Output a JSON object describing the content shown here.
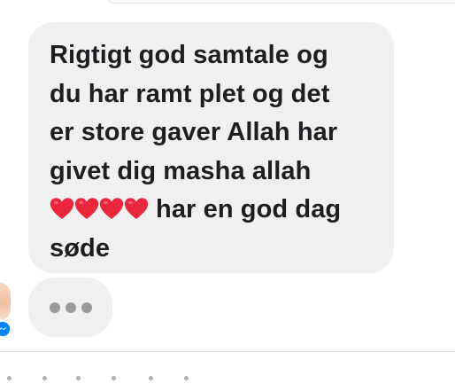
{
  "message": {
    "lines": [
      "Rigtigt god samtale og",
      "du har ramt plet og det",
      "er store gaver Allah har",
      "givet dig  masha allah"
    ],
    "heart_line_text": "har en god dag",
    "last_line": "søde",
    "heart_count": 4,
    "heart_color": "#e8263c"
  },
  "typing_indicator": {
    "dot_color": "#9a9a9a",
    "bubble_color": "#f0f0f0"
  },
  "colors": {
    "bubble": "#f0f0f0",
    "text": "#1c1e21",
    "messenger_blue": "#0084ff"
  }
}
